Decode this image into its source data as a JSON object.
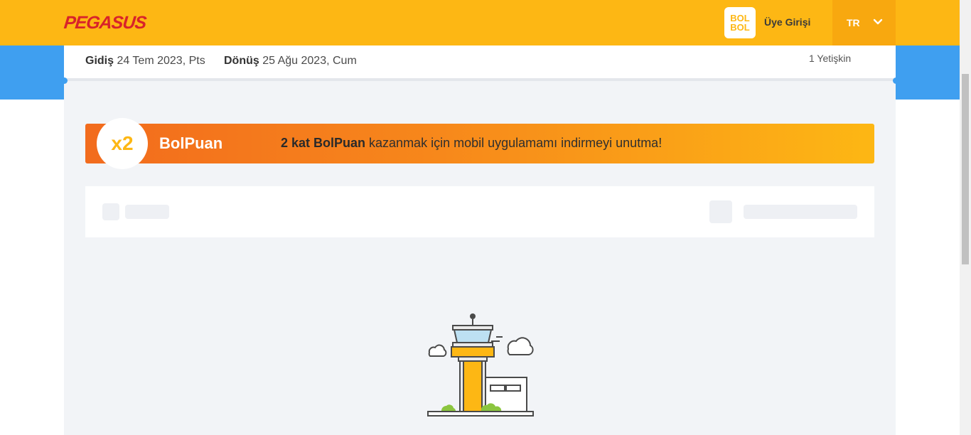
{
  "header": {
    "brand": "PEGASUS",
    "bolbol_line1": "BOL",
    "bolbol_line2": "BOL",
    "login_label": "Üye Girişi",
    "language": "TR"
  },
  "search_summary": {
    "departure_label": "Gidiş",
    "departure_date": "24 Tem 2023, Pts",
    "return_label": "Dönüş",
    "return_date": "25 Ağu 2023, Cum",
    "passengers": "1 Yetişkin"
  },
  "promo": {
    "multiplier": "x2",
    "brand": "BolPuan",
    "highlight": "2 kat BolPuan",
    "message": " kazanmak için mobil uygulamamı indirmeyi unutma!"
  },
  "colors": {
    "header": "#fdb714",
    "brand_red": "#d8232a",
    "band_blue": "#3f9ff0",
    "promo_start": "#f26b1d",
    "promo_end": "#fdb714"
  },
  "icons": {
    "logo": "pegasus-logo",
    "bolbol": "bolbol-logo",
    "language_toggle": "chevron-down-icon",
    "illustration": "control-tower-illustration"
  }
}
